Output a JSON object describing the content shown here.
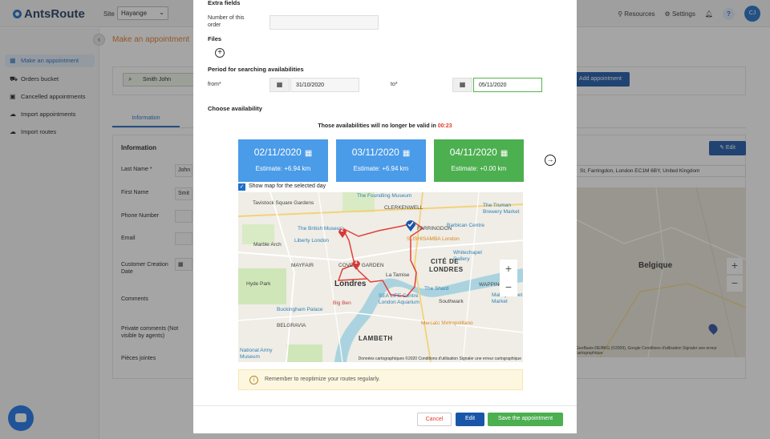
{
  "app": {
    "logo": "AntsRoute",
    "site_label": "Site",
    "site_value": "Hayange",
    "resources": "Resources",
    "settings": "Settings",
    "help": "?",
    "avatar": "CJ"
  },
  "sidebar": {
    "items": [
      {
        "label": "Make an appointment",
        "icon": "calendar-icon"
      },
      {
        "label": "Orders bucket",
        "icon": "cart-icon"
      },
      {
        "label": "Cancelled appointments",
        "icon": "cancel-calendar-icon"
      },
      {
        "label": "Import appointments",
        "icon": "cloud-upload-icon"
      },
      {
        "label": "Import routes",
        "icon": "cloud-upload-icon"
      }
    ]
  },
  "main": {
    "title": "Make an appointment",
    "search_value": "Smith John",
    "add_appointment": "Add appointment",
    "tab_information": "Information",
    "info_heading": "Information",
    "edit": "Edit",
    "address": "St, Farringdon, London EC1M 6BY, United Kingdom",
    "labels": {
      "last_name": "Last Name *",
      "first_name": "First Name",
      "phone": "Phone Number",
      "email": "Email",
      "creation_date": "Customer Creation Date",
      "comments": "Comments",
      "private_comments": "Private comments (Not visible by agents)",
      "attachments": "Pièces jointes"
    },
    "values": {
      "last_name": "John",
      "first_name": "Smit"
    },
    "map": {
      "country": "Belgique",
      "credit": "GeoBasis-DE/BKG (©2009), Google   Conditions d'utilisation   Signaler une erreur cartographique"
    }
  },
  "modal": {
    "extra_fields": "Extra fields",
    "number_of_order_label": "Number of this order",
    "number_of_order_value": "",
    "files": "Files",
    "period_heading": "Period for searching availabilities",
    "from_label": "from*",
    "from_value": "31/10/2020",
    "to_label": "to*",
    "to_value": "05/11/2020",
    "choose_availability": "Choose availability",
    "validity_text": "Those availabilities will no longer be valid in",
    "validity_timer": "00:23",
    "days": [
      {
        "date": "02/11/2020",
        "estimate": "Estimate: +6.94 km",
        "color": "#4a9be8"
      },
      {
        "date": "03/11/2020",
        "estimate": "Estimate: +6.94 km",
        "color": "#4a9be8"
      },
      {
        "date": "04/11/2020",
        "estimate": "Estimate: +0.00 km",
        "color": "#4caf50"
      }
    ],
    "show_map": "Show map for the selected day",
    "map_labels": {
      "foundling": "The Foundling Museum",
      "tavistock": "Tavistock Square Gardens",
      "clerkenwell": "CLERKENWELL",
      "truman": "The Truman Brewery Market",
      "british_museum": "The British Museum",
      "farringdon": "FARRINGDON",
      "barbican": "Barbican Centre",
      "liberty": "Liberty London",
      "marble_arch": "Marble Arch",
      "sushisamba": "SUSHISAMBA London",
      "cite": "CITÉ DE",
      "londres_city": "LONDRES",
      "whitechapel": "Whitechapel Gallery",
      "mayfair": "MAYFAIR",
      "covent": "COVENT GARDEN",
      "hyde_park": "Hyde Park",
      "londres": "Londres",
      "tamise": "La Tamise",
      "shard": "The Shard",
      "wapping": "WAPPING",
      "big_ben": "Big Ben",
      "sea_life": "SEA LIFE Centre London Aquarium",
      "buckingham": "Buckingham Palace",
      "southwark": "Southwark",
      "maltby": "Maltby Street Market",
      "belgravia": "BELGRAVIA",
      "mercato": "Mercato Metropolitano",
      "lambeth": "LAMBETH",
      "army_museum": "National Army Museum",
      "credit": "Données cartographiques ©2020    Conditions d'utilisation    Signaler une erreur cartographique"
    },
    "pins": [
      "2",
      "1"
    ],
    "reminder": "Remember to reoptimize your routes regularly.",
    "cancel": "Cancel",
    "edit": "Edit",
    "save": "Save the appointment"
  }
}
